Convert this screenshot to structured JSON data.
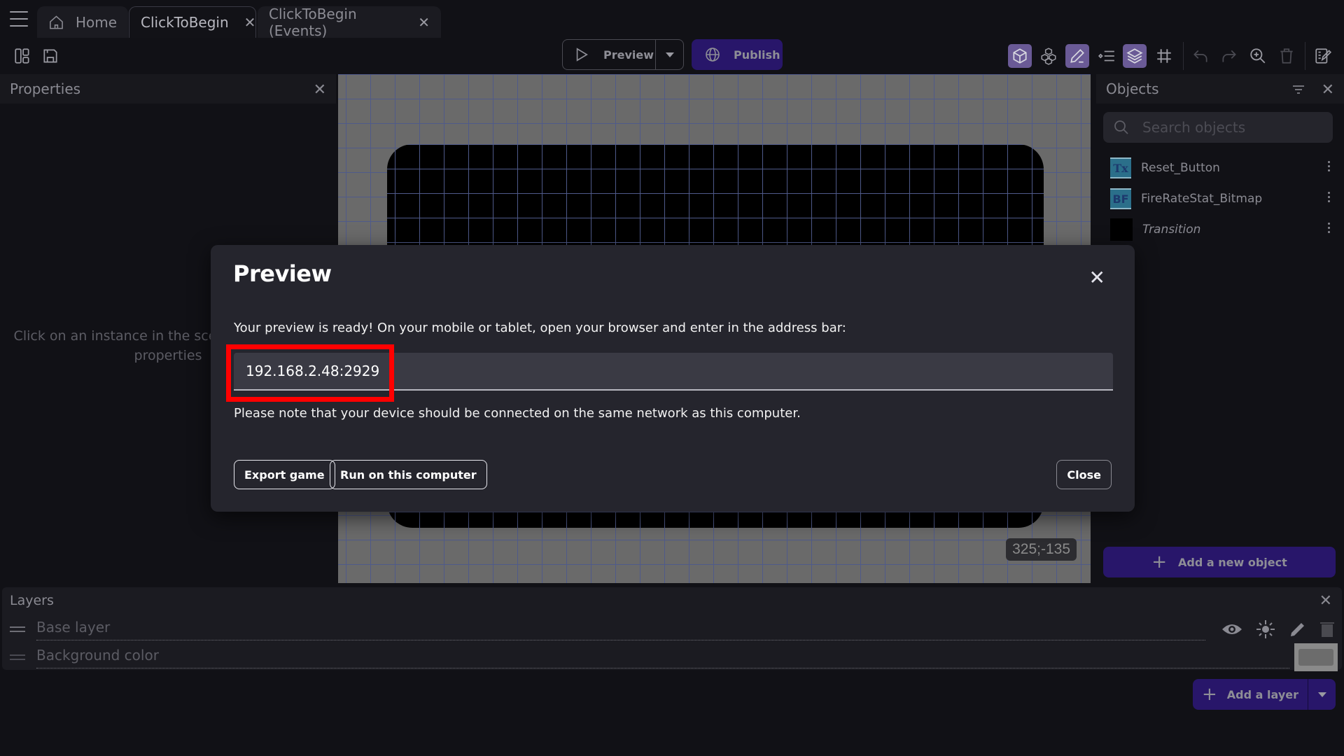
{
  "tabs": [
    {
      "label": "Home",
      "icon": "home-icon",
      "closable": false
    },
    {
      "label": "ClickToBegin",
      "active": true,
      "closable": true
    },
    {
      "label": "ClickToBegin (Events)",
      "closable": true
    }
  ],
  "toolbar": {
    "preview_label": "Preview",
    "publish_label": "Publish",
    "icons": [
      "layout-panels-icon",
      "save-icon",
      "objects-3d-icon",
      "object-groups-icon",
      "edit-icon",
      "instances-list-icon",
      "layers-icon",
      "grid-icon",
      "undo-icon",
      "redo-icon",
      "zoom-in-icon",
      "delete-icon",
      "scene-properties-icon"
    ]
  },
  "properties": {
    "title": "Properties",
    "empty_line1": "Click on an instance in the scene to display its",
    "empty_line2": "properties"
  },
  "canvas": {
    "coordinates": "325;-135"
  },
  "objects": {
    "title": "Objects",
    "search_placeholder": "Search objects",
    "items": [
      {
        "name": "Reset_Button",
        "type": "text",
        "thumb": "Tx",
        "italic": false
      },
      {
        "name": "FireRateStat_Bitmap",
        "type": "bitmap-text",
        "thumb": "BF",
        "italic": false
      },
      {
        "name": "Transition",
        "type": "shape",
        "thumb": "",
        "italic": true
      }
    ],
    "add_label": "Add a new object"
  },
  "layers": {
    "title": "Layers",
    "rows": [
      {
        "name": "Base layer"
      },
      {
        "name": "Background color"
      }
    ],
    "add_label": "Add a layer"
  },
  "modal": {
    "title": "Preview",
    "message": "Your preview is ready! On your mobile or tablet, open your browser and enter in the address bar:",
    "url": "192.168.2.48:2929",
    "note": "Please note that your device should be connected on the same network as this computer.",
    "buttons": {
      "export": "Export game",
      "run": "Run on this computer",
      "close": "Close"
    }
  },
  "colors": {
    "accent": "#28166a",
    "toggle_active": "#6a5a96",
    "highlight": "#ff0000"
  }
}
